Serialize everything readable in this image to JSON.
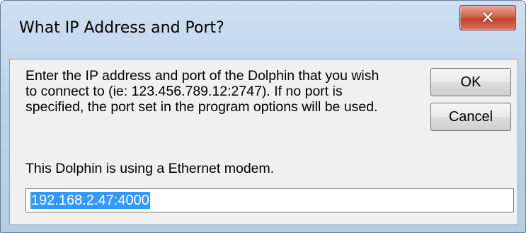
{
  "window": {
    "title": "What IP Address and Port?"
  },
  "icons": {
    "close": "close-icon"
  },
  "close_glyph": "✕",
  "dialog": {
    "message": "Enter the IP address and port of the Dolphin that you wish to connect to (ie: 123.456.789.12:2747). If no port is specified, the port set in the program options will be used.",
    "status": "This Dolphin is using a Ethernet modem.",
    "ip_value": "192.168.2.47:4000",
    "ok_label": "OK",
    "cancel_label": "Cancel"
  },
  "colors": {
    "title_bar": "#bcd3ea",
    "close_button": "#c0402a",
    "selection_highlight": "#3399ff",
    "client_background": "#f0f0f0"
  }
}
